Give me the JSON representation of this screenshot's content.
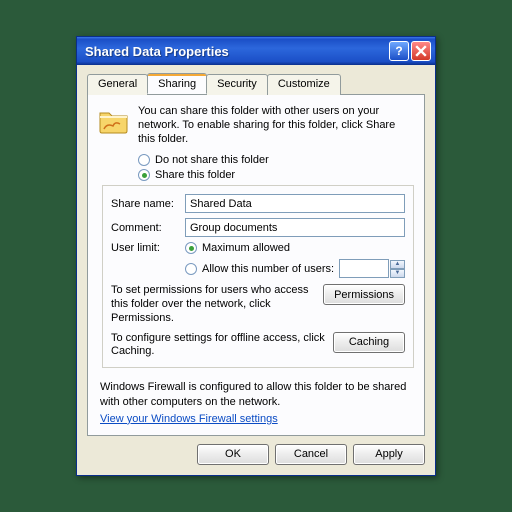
{
  "window": {
    "title": "Shared Data Properties"
  },
  "tabs": {
    "general": "General",
    "sharing": "Sharing",
    "security": "Security",
    "customize": "Customize"
  },
  "intro": "You can share this folder with other users on your network.  To enable sharing for this folder, click Share this folder.",
  "radios": {
    "do_not_share": "Do not share this folder",
    "share": "Share this folder"
  },
  "fields": {
    "share_name_label": "Share name:",
    "share_name_value": "Shared Data",
    "comment_label": "Comment:",
    "comment_value": "Group documents",
    "user_limit_label": "User limit:",
    "max_allowed": "Maximum allowed",
    "allow_n": "Allow this number of users:"
  },
  "perm": {
    "text": "To set permissions for users who access this folder over the network, click Permissions.",
    "button": "Permissions"
  },
  "cache": {
    "text": "To configure settings for offline access, click Caching.",
    "button": "Caching"
  },
  "firewall": {
    "text": "Windows Firewall is configured to allow this folder to be shared with other computers on the network.",
    "link": "View your Windows Firewall settings"
  },
  "buttons": {
    "ok": "OK",
    "cancel": "Cancel",
    "apply": "Apply"
  }
}
